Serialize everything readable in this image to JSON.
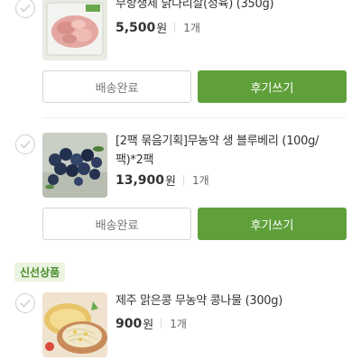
{
  "items": [
    {
      "name": "무항생제 닭다리살(정육) (350g)",
      "price": "5,500",
      "currency": "원",
      "qty": "1개",
      "image_icon": "chicken-thigh-image",
      "delivered_label": "배송완료",
      "review_label": "후기쓰기"
    },
    {
      "name": "[2팩 묶음기획]무농약 생 블루베리 (100g/팩)*2팩",
      "price": "13,900",
      "currency": "원",
      "qty": "1개",
      "image_icon": "blueberry-image",
      "delivered_label": "배송완료",
      "review_label": "후기쓰기"
    },
    {
      "name": "제주 맑은콩 무농약 콩나물 (300g)",
      "price": "900",
      "currency": "원",
      "qty": "1개",
      "image_icon": "bean-sprout-image"
    }
  ],
  "section_badge": "신선상품",
  "colors": {
    "accent_green": "#5fa03a",
    "badge_bg": "#eaf4e1",
    "badge_text": "#4c8b2b"
  }
}
